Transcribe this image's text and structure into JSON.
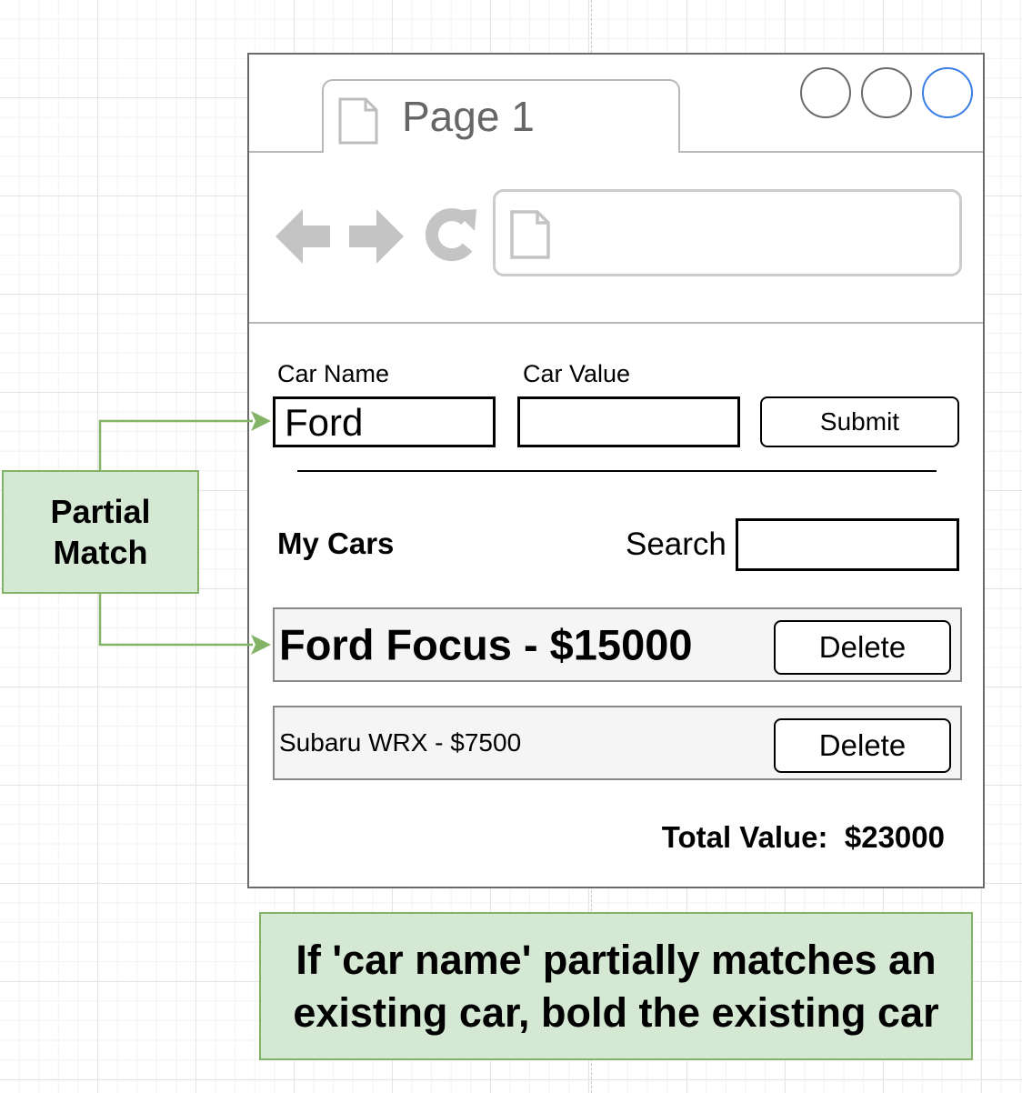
{
  "browser": {
    "tab_title": "Page 1",
    "icons": [
      "document-icon",
      "back-arrow-icon",
      "forward-arrow-icon",
      "refresh-icon",
      "circle-button-icon"
    ]
  },
  "form": {
    "car_name_label": "Car Name",
    "car_name_value": "Ford",
    "car_value_label": "Car Value",
    "car_value_value": "",
    "submit_label": "Submit"
  },
  "list": {
    "heading": "My Cars",
    "search_label": "Search",
    "search_value": "",
    "cars": [
      {
        "text": "Ford Focus - $15000",
        "bold": true,
        "delete_label": "Delete"
      },
      {
        "text": "Subaru WRX - $7500",
        "bold": false,
        "delete_label": "Delete"
      }
    ],
    "total_label": "Total Value:",
    "total_value": "$23000"
  },
  "annotations": {
    "partial_match_line1": "Partial",
    "partial_match_line2": "Match",
    "rule_line1": "If 'car name' partially matches an",
    "rule_line2": "existing car, bold the existing car",
    "fill_color": "#d5e8d4",
    "stroke_color": "#82b366"
  },
  "colors": {
    "window_border": "#6b6b6b",
    "highlight_circle": "#3a7ee4"
  }
}
